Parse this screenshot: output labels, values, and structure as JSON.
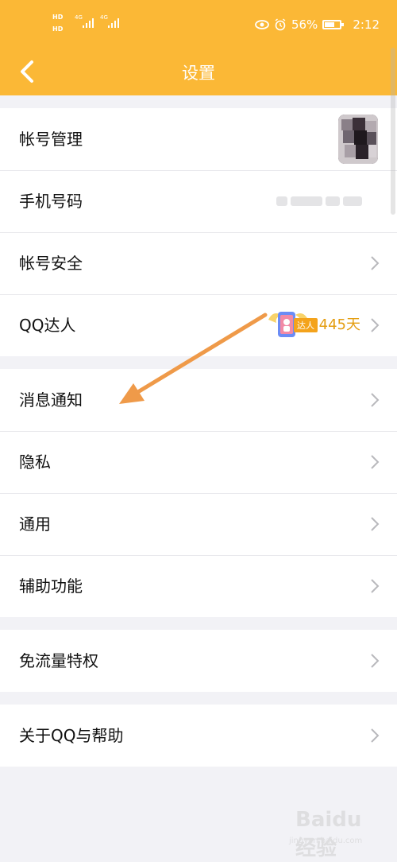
{
  "status_bar": {
    "hd1": "HD",
    "hd2": "HD",
    "net1": "4G",
    "net2": "4G",
    "battery_percent_text": "56%",
    "battery_level": 0.56,
    "time": "2:12",
    "icons": [
      "eye-icon",
      "alarm-icon",
      "battery-icon"
    ]
  },
  "nav": {
    "title": "设置",
    "back_icon": "chevron-left-icon"
  },
  "groups": [
    {
      "rows": [
        {
          "label": "帐号管理",
          "right": "avatar"
        },
        {
          "label": "手机号码",
          "right": "masked-number"
        },
        {
          "label": "帐号安全",
          "right": "chevron"
        },
        {
          "label": "QQ达人",
          "right": "badge-days"
        }
      ]
    },
    {
      "rows": [
        {
          "label": "消息通知",
          "right": "chevron"
        },
        {
          "label": "隐私",
          "right": "chevron"
        },
        {
          "label": "通用",
          "right": "chevron"
        },
        {
          "label": "辅助功能",
          "right": "chevron"
        }
      ]
    },
    {
      "rows": [
        {
          "label": "免流量特权",
          "right": "chevron"
        }
      ]
    },
    {
      "rows": [
        {
          "label": "关于QQ与帮助",
          "right": "chevron"
        }
      ]
    }
  ],
  "qq_daren": {
    "badge_text": "达人",
    "days_text": "445天"
  },
  "colors": {
    "header": "#fbb836",
    "annotation_arrow": "#ef9a49",
    "days": "#e49d10"
  },
  "watermark": {
    "text": "Baidu 经验",
    "sub": "jingyan.baidu.com"
  }
}
